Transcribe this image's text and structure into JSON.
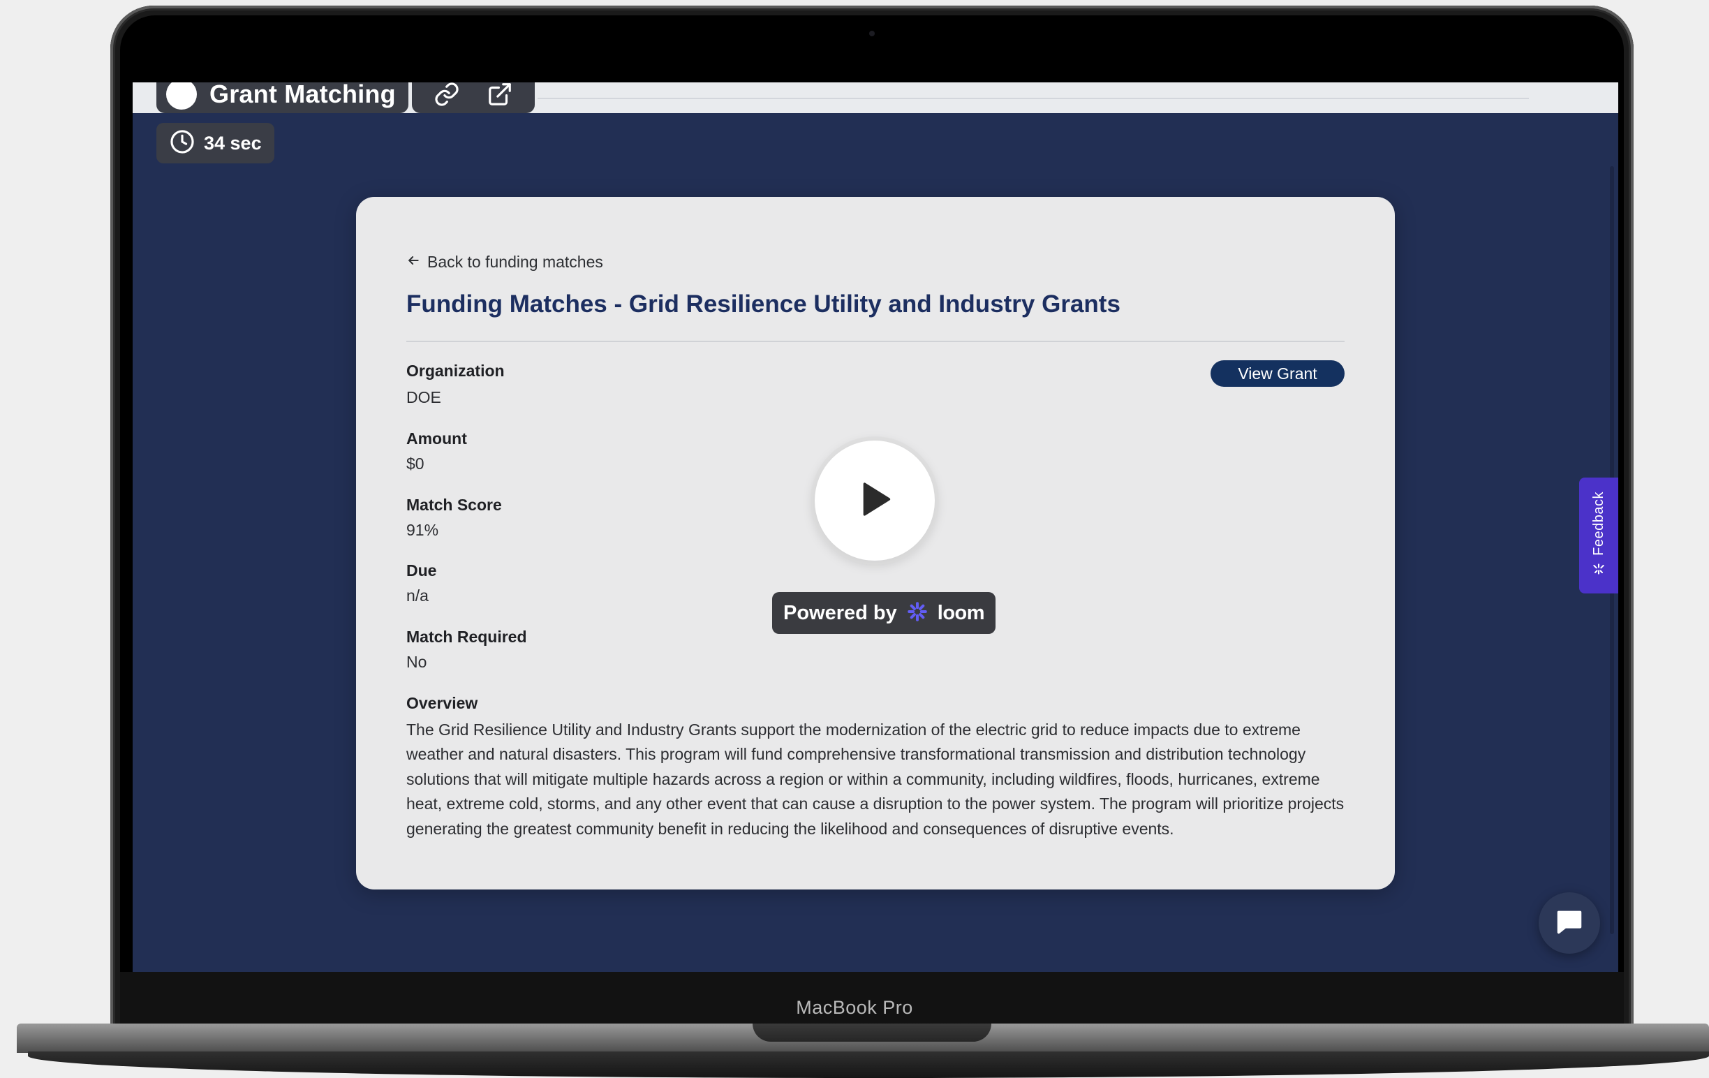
{
  "video": {
    "title": "Grant Matching",
    "duration": "34 sec"
  },
  "page": {
    "back_link": "Back to funding matches",
    "title": "Funding Matches - Grid Resilience Utility and Industry Grants",
    "view_grant_label": "View Grant"
  },
  "fields": {
    "organization": {
      "label": "Organization",
      "value": "DOE"
    },
    "amount": {
      "label": "Amount",
      "value": "$0"
    },
    "match_score": {
      "label": "Match Score",
      "value": "91%"
    },
    "due": {
      "label": "Due",
      "value": "n/a"
    },
    "match_required": {
      "label": "Match Required",
      "value": "No"
    },
    "overview": {
      "label": "Overview",
      "value": "The Grid Resilience Utility and Industry Grants support the modernization of the electric grid to reduce impacts due to extreme weather and natural disasters. This program will fund comprehensive transformational transmission and distribution technology solutions that will mitigate multiple hazards across a region or within a community, including wildfires, floods, hurricanes, extreme heat, extreme cold, storms, and any other event that can cause a disruption to the power system. The program will prioritize projects generating the greatest community benefit in reducing the likelihood and consequences of disruptive events."
    }
  },
  "player": {
    "powered_by": "Powered by",
    "brand": "loom"
  },
  "widgets": {
    "feedback_label": "Feedback"
  },
  "device": {
    "label": "MacBook Pro"
  },
  "colors": {
    "screen_background": "#222f54",
    "title_navy": "#1c2e60",
    "button_navy": "#14315f",
    "feedback_purple": "#4b32c9",
    "loom_purple": "#625df5"
  },
  "icons": {
    "back": "arrow-left-icon",
    "link": "link-icon",
    "external": "external-link-icon",
    "clock": "clock-icon",
    "play": "play-icon",
    "loom": "loom-logo-icon",
    "chat": "chat-icon",
    "feedback": "feedback-icon"
  }
}
